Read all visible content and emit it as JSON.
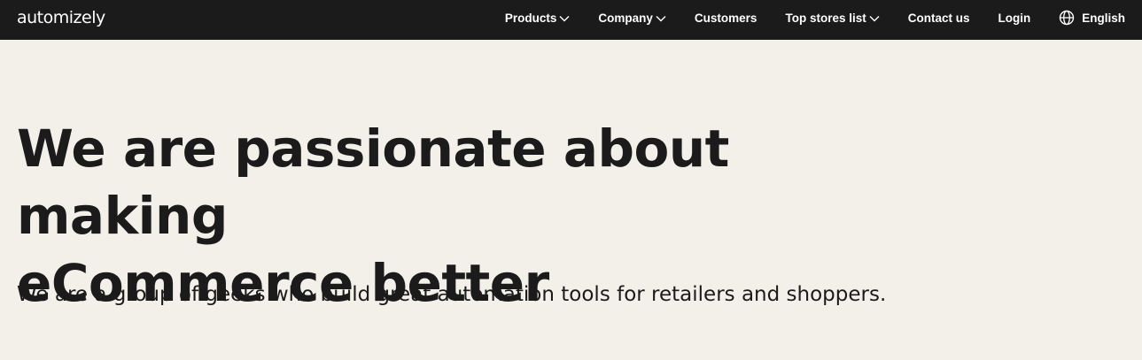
{
  "header": {
    "logo_text": "automizely",
    "background": "#1b1b1b",
    "nav": {
      "products": "Products",
      "company": "Company",
      "customers": "Customers",
      "top_stores": "Top stores list",
      "contact": "Contact us",
      "login": "Login",
      "language": "English"
    }
  },
  "hero": {
    "title_line1": "We are passionate about making",
    "title_line2": "eCommerce better",
    "subtitle": "We are a group of geeks who build great automation tools for retailers and shoppers.",
    "background": "#f3f0ea"
  },
  "icons": {
    "dropdown": "chevron-down-icon",
    "language": "globe-icon"
  }
}
